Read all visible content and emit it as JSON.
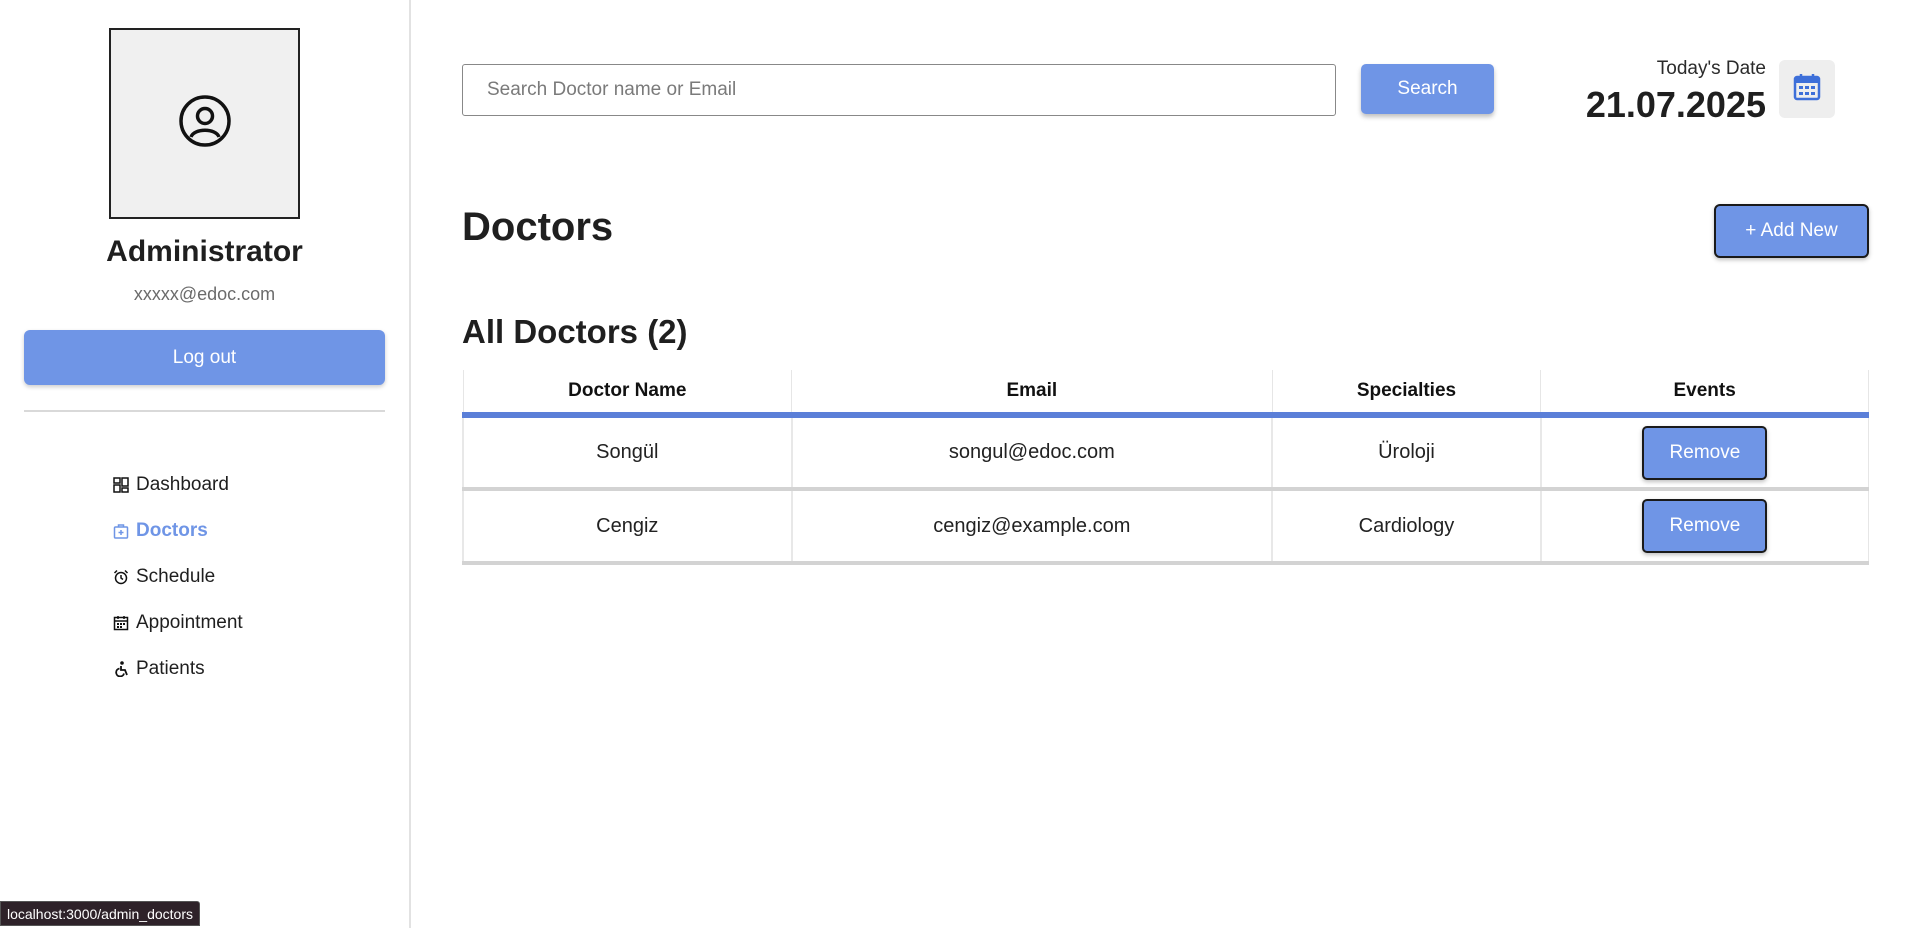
{
  "sidebar": {
    "profile": {
      "name": "Administrator",
      "email": "xxxxx@edoc.com",
      "avatar_icon": "user-circle-icon"
    },
    "logout_label": "Log out",
    "menu": [
      {
        "label": "Dashboard",
        "icon": "dashboard-icon",
        "active": false
      },
      {
        "label": "Doctors",
        "icon": "doctor-icon",
        "active": true
      },
      {
        "label": "Schedule",
        "icon": "alarm-clock-icon",
        "active": false
      },
      {
        "label": "Appointment",
        "icon": "calendar-icon",
        "active": false
      },
      {
        "label": "Patients",
        "icon": "wheelchair-icon",
        "active": false
      }
    ]
  },
  "header": {
    "search_placeholder": "Search Doctor name or Email",
    "search_button": "Search",
    "date_label": "Today's Date",
    "date_value": "21.07.2025"
  },
  "main": {
    "page_title": "Doctors",
    "add_new_label": "+ Add New",
    "section_title": "All Doctors (2)",
    "table": {
      "columns": [
        "Doctor Name",
        "Email",
        "Specialties",
        "Events"
      ],
      "rows": [
        {
          "name": "Songül",
          "email": "songul@edoc.com",
          "specialty": "Üroloji",
          "action": "Remove"
        },
        {
          "name": "Cengiz",
          "email": "cengiz@example.com",
          "specialty": "Cardiology",
          "action": "Remove"
        }
      ]
    }
  },
  "status_bar": {
    "url": "localhost:3000/admin_doctors"
  },
  "colors": {
    "accent": "#6f95e6",
    "table_header_border": "#5b7fd8",
    "calendar_icon": "#3d6fd9"
  }
}
